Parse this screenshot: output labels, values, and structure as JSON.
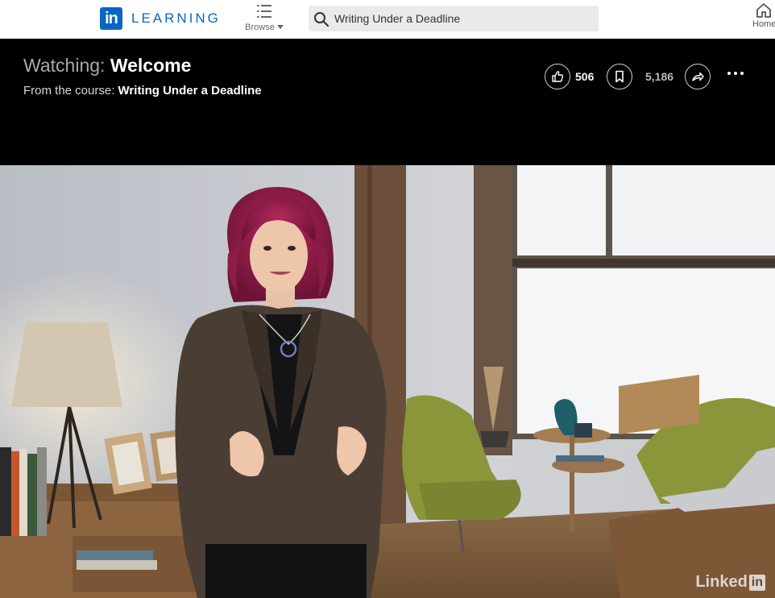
{
  "nav": {
    "brand_in": "in",
    "brand_word": "LEARNING",
    "browse_label": "Browse",
    "search_value": "Writing Under a Deadline",
    "home_label": "Home"
  },
  "header": {
    "watching_prefix": "Watching:",
    "video_title": "Welcome",
    "course_prefix": "From the course:",
    "course_name": "Writing Under a Deadline",
    "like_count": "506",
    "save_count": "5,186"
  },
  "video": {
    "watermark_text": "Linked",
    "watermark_in": "in"
  },
  "icons": {
    "logo": "linkedin-logo",
    "browse": "list-icon",
    "search": "search-icon",
    "home": "home-icon",
    "like": "thumbs-up-icon",
    "save": "bookmark-icon",
    "share": "share-arrow-icon",
    "more": "more-dots-icon"
  },
  "colors": {
    "brand": "#0a66c2",
    "header_bg": "#000000"
  }
}
